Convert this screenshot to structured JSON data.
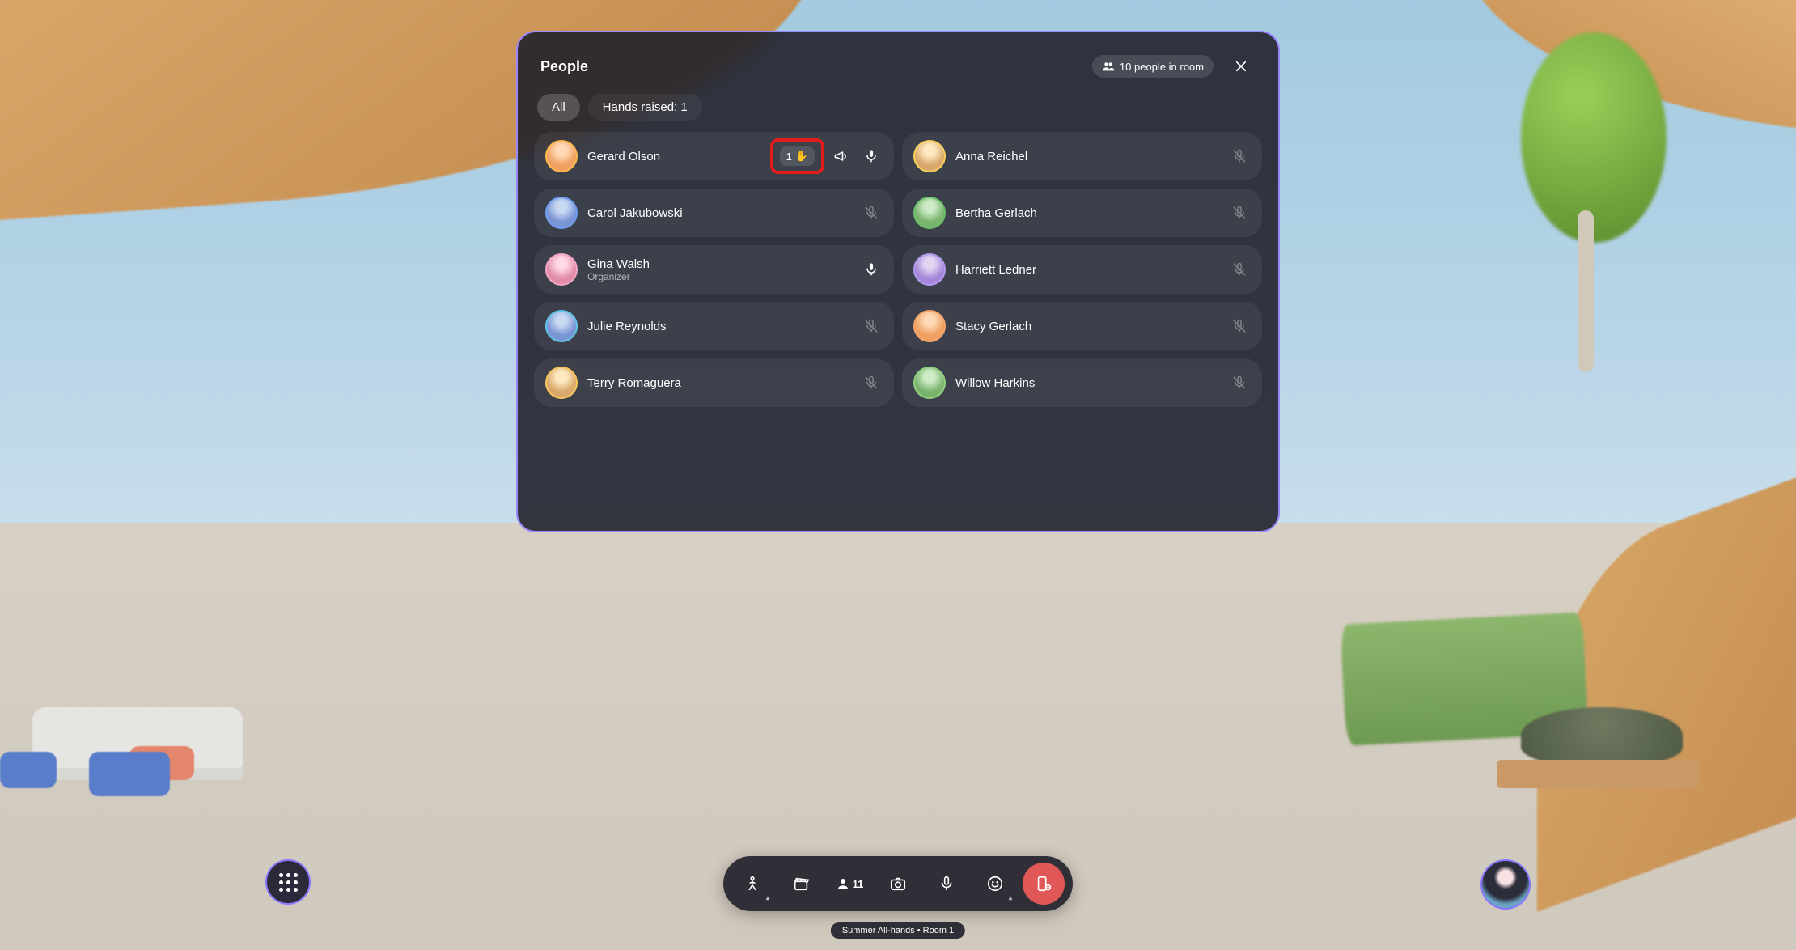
{
  "panel": {
    "title": "People",
    "room_count_label": "10 people in room",
    "tabs": {
      "all": "All",
      "hands_raised": "Hands raised: 1"
    }
  },
  "people": [
    {
      "name": "Gerard Olson",
      "role": null,
      "hand_order": 1,
      "megaphone": true,
      "mic": "on",
      "avatar": "av-orange av0"
    },
    {
      "name": "Anna Reichel",
      "role": null,
      "hand_order": null,
      "megaphone": false,
      "mic": "off",
      "avatar": "av-yellow av1"
    },
    {
      "name": "Carol Jakubowski",
      "role": null,
      "hand_order": null,
      "megaphone": false,
      "mic": "off",
      "avatar": "av-blue av3"
    },
    {
      "name": "Bertha Gerlach",
      "role": null,
      "hand_order": null,
      "megaphone": false,
      "mic": "off",
      "avatar": "av-green av2"
    },
    {
      "name": "Gina Walsh",
      "role": "Organizer",
      "hand_order": null,
      "megaphone": false,
      "mic": "on",
      "avatar": "av-pink av4"
    },
    {
      "name": "Harriett Ledner",
      "role": null,
      "hand_order": null,
      "megaphone": false,
      "mic": "off",
      "avatar": "av-purple av5"
    },
    {
      "name": "Julie Reynolds",
      "role": null,
      "hand_order": null,
      "megaphone": false,
      "mic": "off",
      "avatar": "av-blue av6"
    },
    {
      "name": "Stacy Gerlach",
      "role": null,
      "hand_order": null,
      "megaphone": false,
      "mic": "off",
      "avatar": "av-orange av7"
    },
    {
      "name": "Terry Romaguera",
      "role": null,
      "hand_order": null,
      "megaphone": false,
      "mic": "off",
      "avatar": "av-yellow av8"
    },
    {
      "name": "Willow Harkins",
      "role": null,
      "hand_order": null,
      "megaphone": false,
      "mic": "off",
      "avatar": "av-green av9"
    }
  ],
  "bottom_bar": {
    "participant_count": "11"
  },
  "room_label": "Summer All-hands • Room 1",
  "icons": {
    "hand_emoji": "✋"
  }
}
